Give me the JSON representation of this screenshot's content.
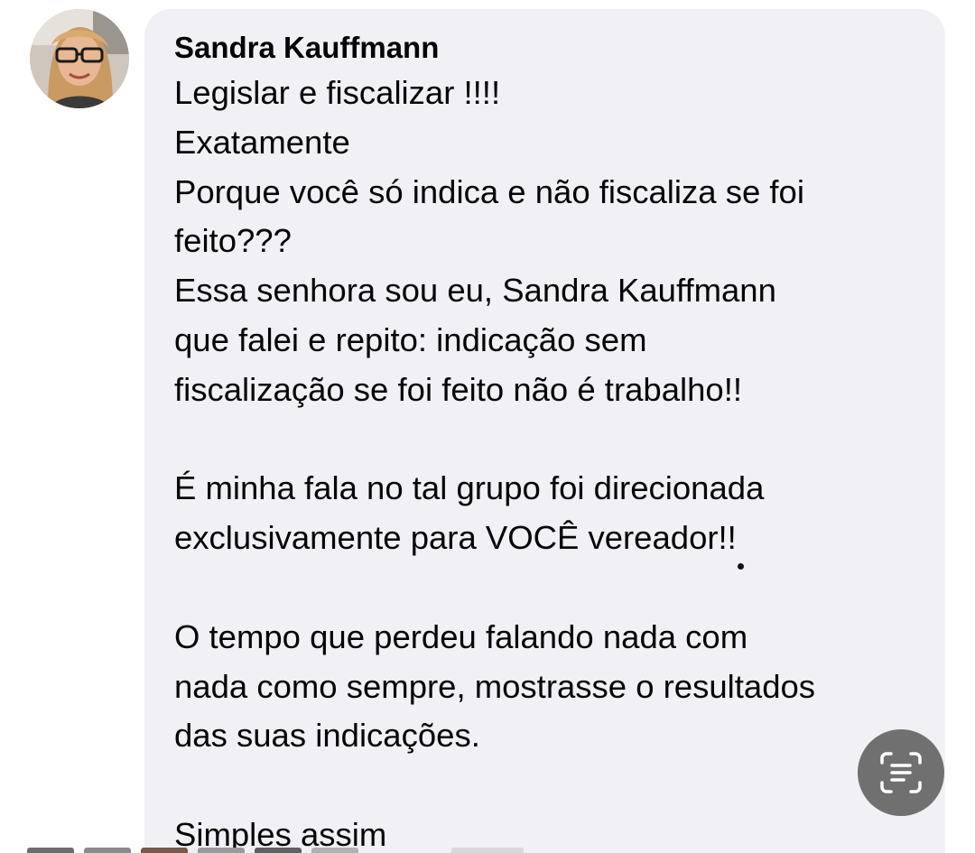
{
  "comment": {
    "author": "Sandra Kauffmann",
    "lines": [
      "Legislar e fiscalizar !!!!",
      "Exatamente",
      "Porque você só indica e não fiscaliza se foi",
      "feito???",
      "Essa senhora sou eu, Sandra Kauffmann",
      "que falei e repito: indicação sem",
      "fiscalização se foi feito não é trabalho!!",
      "",
      "É minha fala no tal grupo foi direcionada",
      "exclusivamente para VOCÊ vereador!!",
      "",
      "O tempo que perdeu falando nada com",
      "nada como sempre, mostrasse o resultados",
      "das suas indicações.",
      "",
      "Simples assim"
    ]
  },
  "colors": {
    "bubble_background": "#f0f0f5",
    "text": "#050505",
    "live_text_button": "#707070"
  },
  "icons": {
    "avatar": "profile-photo",
    "live_text": "live-text-scan-icon"
  }
}
